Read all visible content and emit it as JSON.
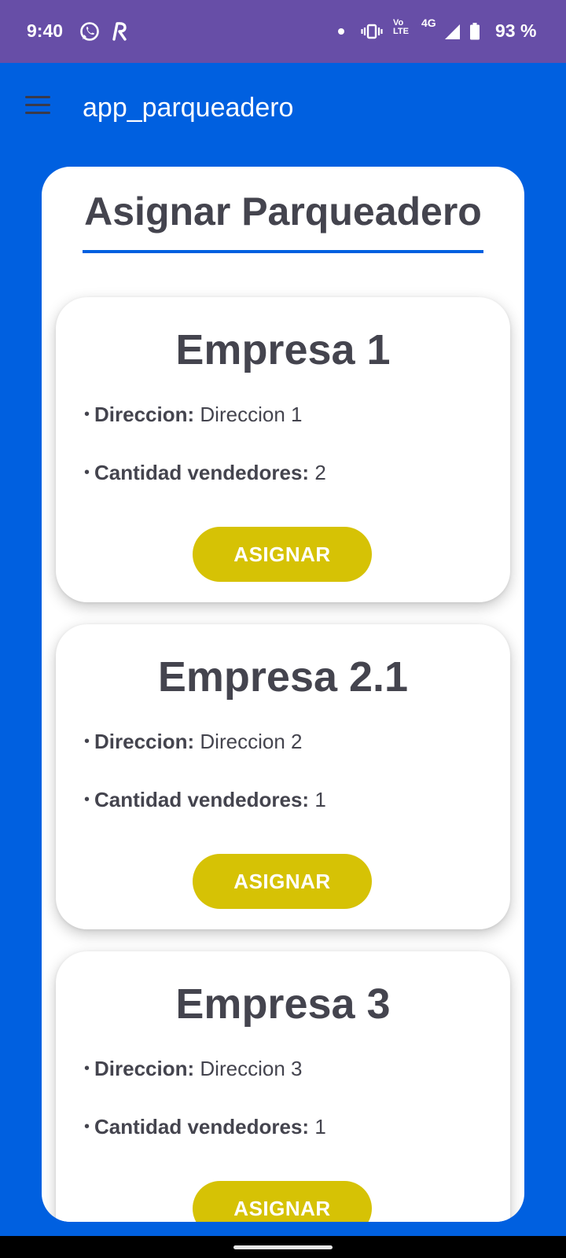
{
  "status_bar": {
    "time": "9:40",
    "icons": [
      "whatsapp-icon",
      "r-app-icon",
      "notification-dot-icon",
      "vibrate-icon",
      "volte-icon",
      "4g-signal-icon",
      "battery-icon"
    ],
    "volte_label_top": "Vo",
    "volte_label_bottom": "LTE",
    "network_label": "4G",
    "battery_percent": "93 %",
    "background_color": "#674ea7"
  },
  "app_bar": {
    "title": "app_parqueadero",
    "menu_icon": "hamburger-menu-icon",
    "background_color": "#0060e0"
  },
  "page": {
    "title": "Asignar Parqueadero",
    "accent_color": "#0060e0",
    "button_color": "#d6c205"
  },
  "companies": [
    {
      "name": "Empresa 1",
      "address_label": "Direccion:",
      "address": "Direccion 1",
      "sellers_label": "Cantidad vendedores:",
      "sellers": "2",
      "button_label": "ASIGNAR"
    },
    {
      "name": "Empresa 2.1",
      "address_label": "Direccion:",
      "address": "Direccion 2",
      "sellers_label": "Cantidad vendedores:",
      "sellers": "1",
      "button_label": "ASIGNAR"
    },
    {
      "name": "Empresa 3",
      "address_label": "Direccion:",
      "address": "Direccion 3",
      "sellers_label": "Cantidad vendedores:",
      "sellers": "1",
      "button_label": "ASIGNAR"
    }
  ],
  "bullet": "•"
}
